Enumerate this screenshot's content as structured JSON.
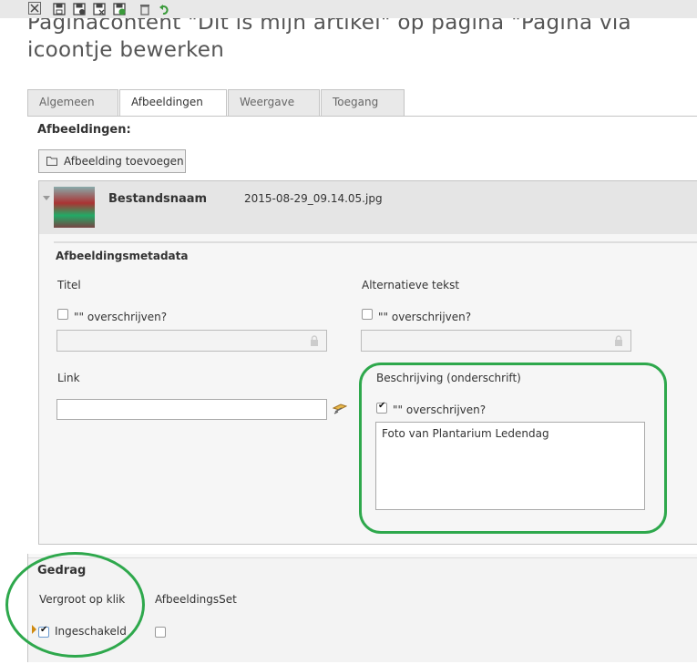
{
  "page_title": "Paginacontent \"Dit is mijn artikel\" op pagina \"Pagina via icoontje bewerken",
  "toolbar": {
    "icons": [
      "close-icon",
      "save-icon",
      "save-view-icon",
      "save-close-icon",
      "save-new-icon",
      "delete-icon",
      "undo-icon"
    ]
  },
  "tabs": [
    "Algemeen",
    "Afbeeldingen",
    "Weergave",
    "Toegang"
  ],
  "active_tab": "Afbeeldingen",
  "images_section_label": "Afbeeldingen:",
  "add_image_button": "Afbeelding toevoegen",
  "file": {
    "name_label": "Bestandsnaam",
    "name_value": "2015-08-29_09.14.05.jpg"
  },
  "metadata": {
    "heading": "Afbeeldingsmetadata",
    "title_label": "Titel",
    "override_label": "\"\" overschrijven?",
    "alt_label": "Alternatieve tekst",
    "link_label": "Link",
    "description_label": "Beschrijving (onderschrift)",
    "description_value": "Foto van Plantarium Ledendag"
  },
  "behavior": {
    "heading": "Gedrag",
    "enlarge_label": "Vergroot op klik",
    "imageset_label": "AfbeeldingsSet",
    "enabled_label": "Ingeschakeld"
  },
  "colors": {
    "highlight": "#2ea84c",
    "panel_bg": "#f7f7f7",
    "tab_bg": "#e9e9e9"
  }
}
